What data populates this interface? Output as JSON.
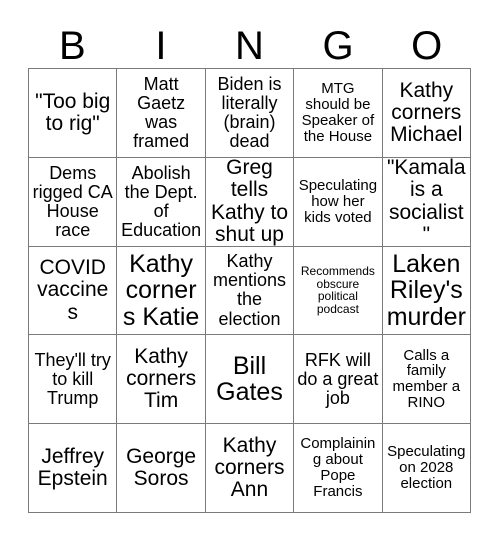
{
  "header": {
    "letters": [
      "B",
      "I",
      "N",
      "G",
      "O"
    ]
  },
  "grid": {
    "rows": 5,
    "columns": 5,
    "border_color": "#7a7a7a",
    "background_color": "#ffffff",
    "text_color": "#000000",
    "cells": [
      {
        "text": "\"Too big to rig\"",
        "size": "lg"
      },
      {
        "text": "Matt Gaetz was framed",
        "size": "md"
      },
      {
        "text": "Biden is literally (brain) dead",
        "size": "md"
      },
      {
        "text": "MTG should be Speaker of the House",
        "size": "sm"
      },
      {
        "text": "Kathy corners Michael",
        "size": "lg"
      },
      {
        "text": "Dems rigged CA House race",
        "size": "md"
      },
      {
        "text": "Abolish the Dept. of Education",
        "size": "md"
      },
      {
        "text": "Greg tells Kathy to shut up",
        "size": "lg"
      },
      {
        "text": "Speculating how her kids voted",
        "size": "sm"
      },
      {
        "text": "\"Kamala is a socialist\"",
        "size": "lg"
      },
      {
        "text": "COVID vaccines",
        "size": "lg"
      },
      {
        "text": "Kathy corners Katie",
        "size": "xl"
      },
      {
        "text": "Kathy mentions the election",
        "size": "md"
      },
      {
        "text": "Recommends obscure political podcast",
        "size": "xs"
      },
      {
        "text": "Laken Riley's murder",
        "size": "xl"
      },
      {
        "text": "They'll try to kill Trump",
        "size": "md"
      },
      {
        "text": "Kathy corners Tim",
        "size": "lg"
      },
      {
        "text": "Bill Gates",
        "size": "xl"
      },
      {
        "text": "RFK will do a great job",
        "size": "md"
      },
      {
        "text": "Calls a family member a RINO",
        "size": "sm"
      },
      {
        "text": "Jeffrey Epstein",
        "size": "lg"
      },
      {
        "text": "George Soros",
        "size": "lg"
      },
      {
        "text": "Kathy corners Ann",
        "size": "lg"
      },
      {
        "text": "Complaining about Pope Francis",
        "size": "sm"
      },
      {
        "text": "Speculating on 2028 election",
        "size": "sm"
      }
    ]
  }
}
